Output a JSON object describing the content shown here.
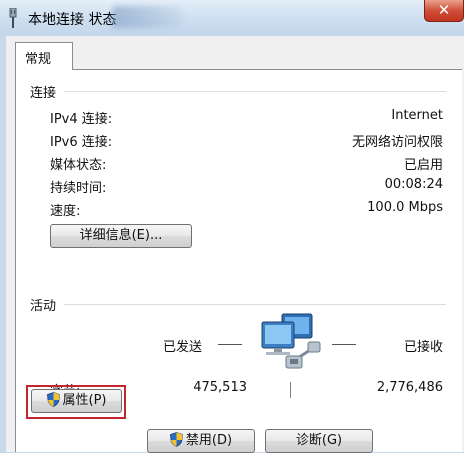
{
  "window": {
    "title": "本地连接 状态",
    "close_glyph": "✕"
  },
  "tabs": [
    {
      "label": "常规"
    }
  ],
  "connection": {
    "group_title": "连接",
    "rows": [
      {
        "label": "IPv4 连接:",
        "value": "Internet"
      },
      {
        "label": "IPv6 连接:",
        "value": "无网络访问权限"
      },
      {
        "label": "媒体状态:",
        "value": "已启用"
      },
      {
        "label": "持续时间:",
        "value": "00:08:24"
      },
      {
        "label": "速度:",
        "value": "100.0 Mbps"
      }
    ],
    "details_button": "详细信息(E)..."
  },
  "activity": {
    "group_title": "活动",
    "sent_label": "已发送",
    "received_label": "已接收",
    "bytes_label": "字节:",
    "bytes_sent": "475,513",
    "bytes_received": "2,776,486"
  },
  "buttons": {
    "properties": "属性(P)",
    "disable": "禁用(D)",
    "diagnose": "诊断(G)"
  },
  "icons": {
    "title_icon": "network-adapter-icon",
    "activity_icon": "network-computers-icon",
    "shield_icon": "uac-shield-icon"
  },
  "colors": {
    "title_bar": "#cddff0",
    "close_button": "#c2331d",
    "highlight_box": "#c0282d"
  }
}
